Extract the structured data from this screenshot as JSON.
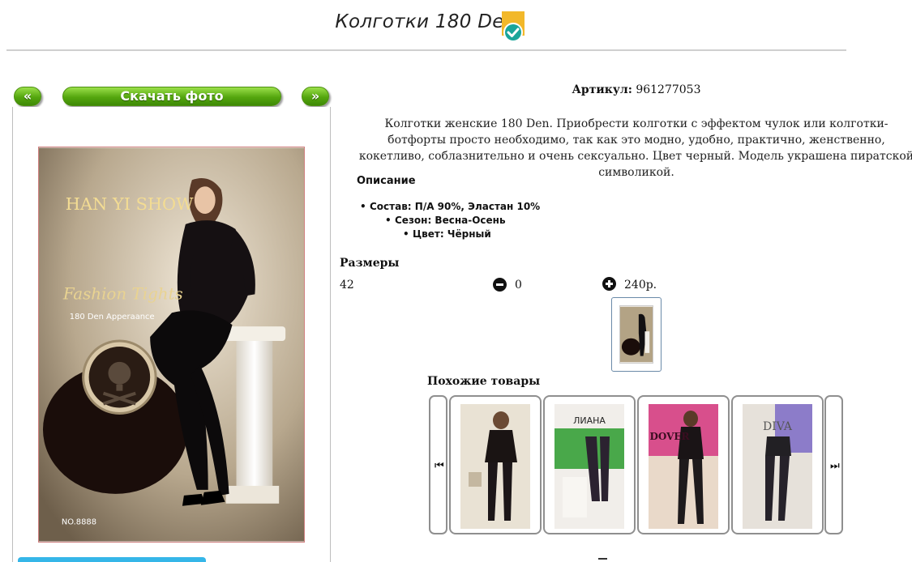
{
  "page": {
    "title": "Колготки 180 Den"
  },
  "gallery": {
    "prev_label": "«",
    "download_label": "Скачать фото",
    "next_label": "»",
    "photo_brand": "HAN YI SHOW",
    "photo_tagline": "Fashion Tights",
    "photo_density": "180 Den Apperaance",
    "photo_model_no": "NO.8888"
  },
  "product": {
    "sku_label": "Артикул:",
    "sku_value": "961277053",
    "description": "Колготки женские 180 Den. Приобрести колготки с эффектом чулок или колготки-ботфорты просто необходимо, так как это модно, удобно, практично, женственно, кокетливо, соблазнительно и очень сексуально. Цвет черный. Модель украшена пиратской символикой.",
    "description_heading": "Описание",
    "specs": [
      "Состав: П/А 90%, Эластан 10%",
      "Сезон: Весна-Осень",
      "Цвет: Чёрный"
    ]
  },
  "sizes": {
    "heading": "Размеры",
    "size": "42",
    "quantity": "0",
    "price": "240р."
  },
  "similar": {
    "heading": "Похожие товары",
    "cards": [
      {
        "label": ""
      },
      {
        "label": "ЛИАНА"
      },
      {
        "label": "DOVER"
      },
      {
        "label": "DIVA"
      }
    ]
  },
  "colors": {
    "accent_green": "#54a60e",
    "badge_orange": "#f2b82a",
    "badge_teal": "#1aa59a"
  }
}
